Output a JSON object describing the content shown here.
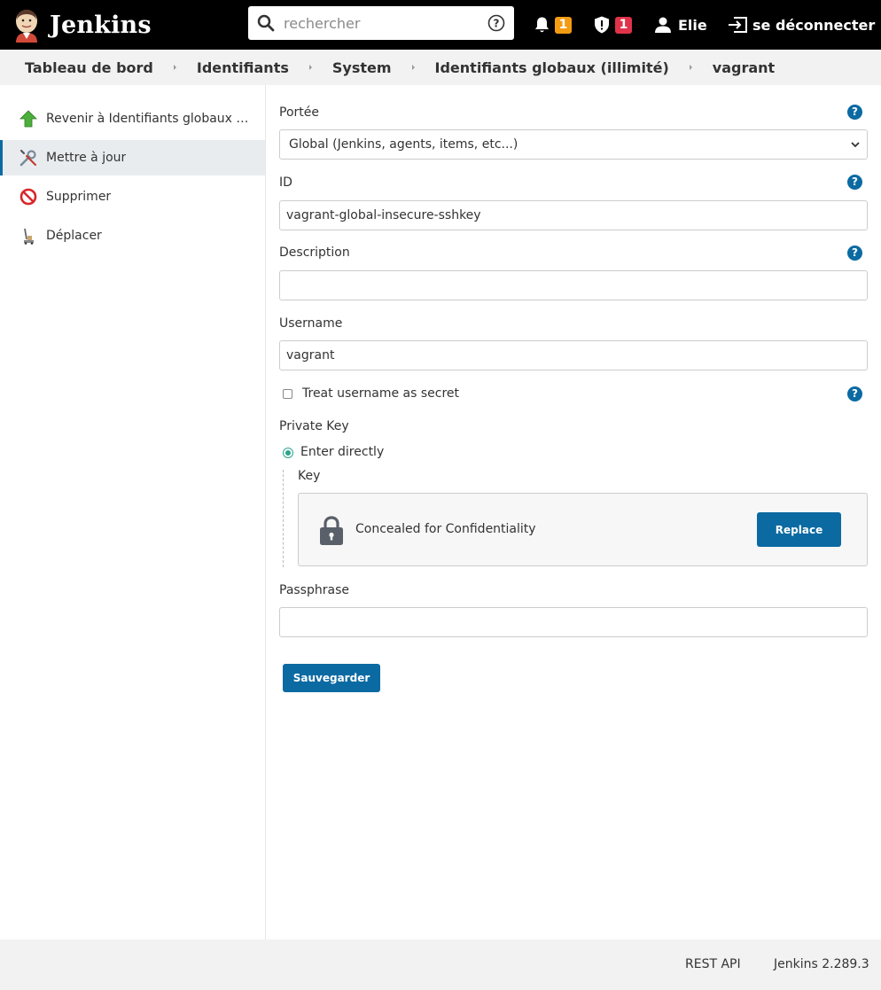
{
  "header": {
    "brand": "Jenkins",
    "search_placeholder": "rechercher",
    "notifications_count": "1",
    "security_count": "1",
    "user_name": "Elie",
    "logout_label": "se déconnecter"
  },
  "breadcrumb": [
    "Tableau de bord",
    "Identifiants",
    "System",
    "Identifiants globaux (illimité)",
    "vagrant"
  ],
  "sidebar": {
    "items": [
      {
        "label": "Revenir à Identifiants globaux (illimité)",
        "icon": "up-arrow-icon"
      },
      {
        "label": "Mettre à jour",
        "icon": "wrench-screwdriver-icon"
      },
      {
        "label": "Supprimer",
        "icon": "no-entry-icon"
      },
      {
        "label": "Déplacer",
        "icon": "move-icon"
      }
    ]
  },
  "form": {
    "scope_label": "Portée",
    "scope_value": "Global (Jenkins, agents, items, etc...)",
    "id_label": "ID",
    "id_value": "vagrant-global-insecure-sshkey",
    "description_label": "Description",
    "description_value": "",
    "username_label": "Username",
    "username_value": "vagrant",
    "treat_secret_label": "Treat username as secret",
    "private_key_label": "Private Key",
    "enter_directly_label": "Enter directly",
    "key_label": "Key",
    "concealed_text": "Concealed for Confidentiality",
    "replace_label": "Replace",
    "passphrase_label": "Passphrase",
    "passphrase_value": "",
    "save_label": "Sauvegarder",
    "help_glyph": "?"
  },
  "footer": {
    "rest_api": "REST API",
    "version": "Jenkins 2.289.3"
  },
  "colors": {
    "accent": "#0b6aa2",
    "radio": "#2aa48c",
    "badge_warning": "#f39c12",
    "badge_danger": "#e0334a"
  }
}
